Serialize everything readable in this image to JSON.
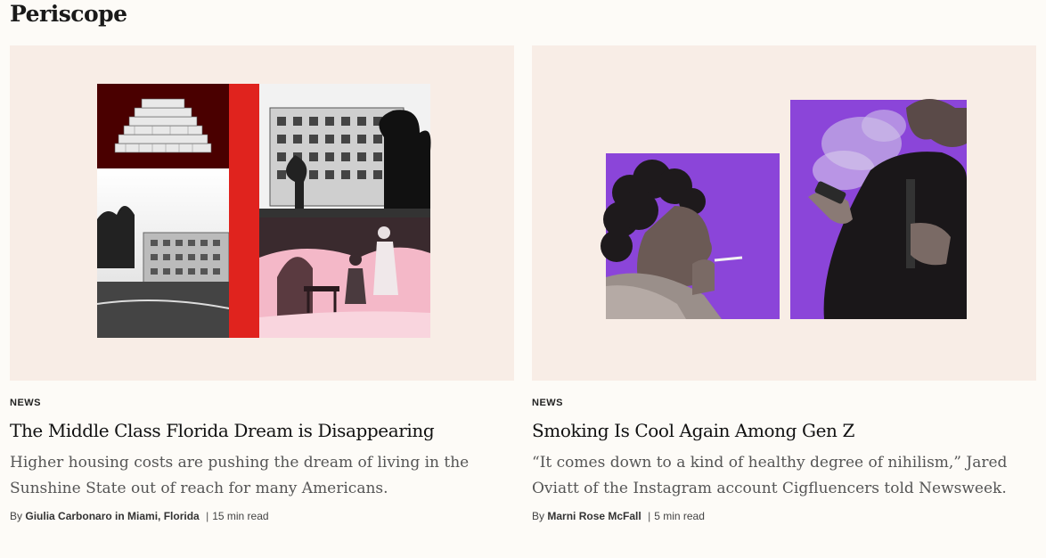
{
  "section": {
    "title": "Periscope"
  },
  "articles": [
    {
      "category": "NEWS",
      "headline": "The Middle Class Florida Dream is Disappearing",
      "dek": "Higher housing costs are pushing the dream of living in the Sunshine State out of reach for many Americans.",
      "byline_prefix": "By",
      "author": "Giulia Carbonaro in Miami, Florida",
      "separator": "|",
      "read_time": "15 min read"
    },
    {
      "category": "NEWS",
      "headline": "Smoking Is Cool Again Among Gen Z",
      "dek": "“It comes down to a kind of healthy degree of nihilism,” Jared Oviatt of the Instagram account Cigfluencers told Newsweek.",
      "byline_prefix": "By",
      "author": "Marni Rose McFall",
      "separator": "|",
      "read_time": "5 min read"
    }
  ],
  "colors": {
    "page_bg": "#fdfbf7",
    "image_bg": "#f8ede6",
    "accent_red": "#e0231e",
    "dark_red": "#4a0000",
    "pink": "#f4b8c8",
    "purple": "#8b45d9"
  }
}
